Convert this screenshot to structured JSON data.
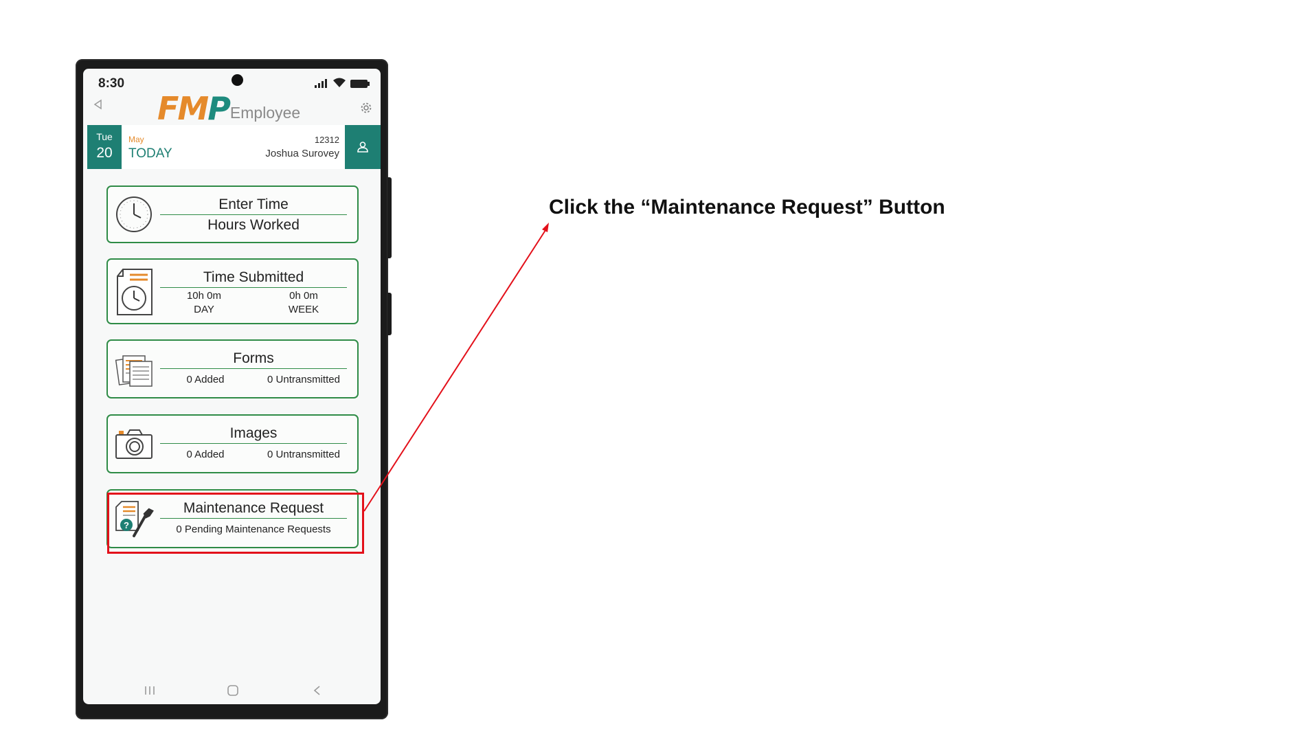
{
  "status_bar": {
    "time": "8:30"
  },
  "header": {
    "logo_main": "FMP",
    "logo_sub": "Employee"
  },
  "date_bar": {
    "day_of_week": "Tue",
    "day": "20",
    "month": "May",
    "today_label": "TODAY",
    "employee_id": "12312",
    "employee_name": "Joshua Surovey"
  },
  "cards": {
    "enter_time": {
      "title": "Enter Time",
      "subtitle": "Hours Worked"
    },
    "time_submitted": {
      "title": "Time Submitted",
      "day_value": "10h 0m",
      "day_label": "DAY",
      "week_value": "0h 0m",
      "week_label": "WEEK"
    },
    "forms": {
      "title": "Forms",
      "added": "0 Added",
      "untransmitted": "0 Untransmitted"
    },
    "images": {
      "title": "Images",
      "added": "0 Added",
      "untransmitted": "0 Untransmitted"
    },
    "maintenance": {
      "title": "Maintenance Request",
      "subtitle": "0 Pending Maintenance Requests"
    }
  },
  "annotation": {
    "instruction": "Click the “Maintenance Request” Button",
    "highlight_color": "#e3101a"
  },
  "colors": {
    "brand_teal": "#1e7f73",
    "brand_orange": "#e58a2b",
    "card_border": "#2e8b46"
  }
}
